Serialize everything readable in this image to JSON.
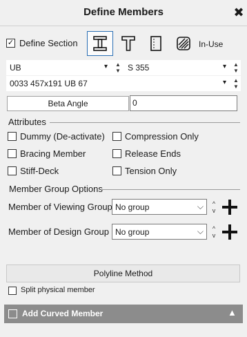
{
  "window": {
    "title": "Define Members"
  },
  "section": {
    "define_section_label": "Define Section",
    "define_section_checked": true,
    "in_use_label": "In-Use",
    "section_type": "UB",
    "material": "S 355",
    "section_name": "0033 457x191 UB 67",
    "beta_angle_label": "Beta Angle",
    "beta_angle_value": "0"
  },
  "attributes": {
    "title": "Attributes",
    "items": [
      {
        "label": "Dummy (De-activate)",
        "checked": false
      },
      {
        "label": "Compression Only",
        "checked": false
      },
      {
        "label": "Bracing Member",
        "checked": false
      },
      {
        "label": "Release Ends",
        "checked": false
      },
      {
        "label": "Stiff-Deck",
        "checked": false
      },
      {
        "label": "Tension Only",
        "checked": false
      }
    ]
  },
  "groups": {
    "title": "Member Group Options",
    "viewing_label": "Member of Viewing Group",
    "viewing_value": "No group",
    "design_label": "Member of Design Group",
    "design_value": "No group"
  },
  "polyline": {
    "button_label": "Polyline Method"
  },
  "split": {
    "label": "Split physical member",
    "checked": false
  },
  "curved": {
    "label": "Add Curved Member",
    "checked": false
  },
  "icons": {
    "close": "close-icon",
    "i_section": "i-section-icon",
    "t_section": "t-section-icon",
    "plate_section": "plate-section-icon",
    "hatched_section": "hatched-section-icon",
    "add": "plus-icon"
  },
  "colors": {
    "accent_border": "#2a6fb5",
    "footer_bar": "#8c8c8c"
  }
}
